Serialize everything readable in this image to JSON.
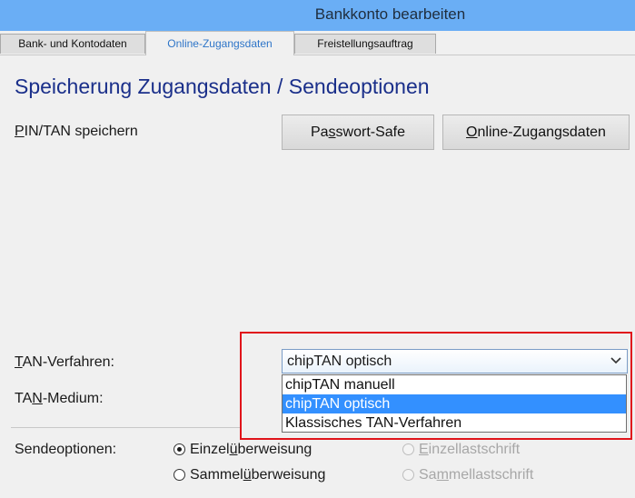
{
  "window": {
    "title": "Bankkonto bearbeiten"
  },
  "tabs": [
    {
      "label": "Bank- und Kontodaten",
      "active": false
    },
    {
      "label": "Online-Zugangsdaten",
      "active": true
    },
    {
      "label": "Freistellungsauftrag",
      "active": false
    }
  ],
  "section": {
    "heading": "Speicherung Zugangsdaten / Sendeoptionen"
  },
  "pin_tan": {
    "label_u": "P",
    "label_rest": "IN/TAN speichern",
    "passwort_safe_pre": "Pa",
    "passwort_safe_u": "s",
    "passwort_safe_post": "swort-Safe",
    "online_zugang_u": "O",
    "online_zugang_rest": "nline-Zugangsdaten"
  },
  "tan_verfahren": {
    "label_u": "T",
    "label_rest": "AN-Verfahren:",
    "selected": "chipTAN optisch",
    "options": [
      "chipTAN manuell",
      "chipTAN optisch",
      "Klassisches TAN-Verfahren"
    ]
  },
  "tan_medium": {
    "label_pre": "TA",
    "label_u": "N",
    "label_rest": "-Medium:"
  },
  "sendeoptionen": {
    "label": "Sendeoptionen:",
    "einzelueberweisung": {
      "pre": "Einzel",
      "u": "ü",
      "post": "berweisung",
      "checked": true
    },
    "sammelueberweisung": {
      "pre": "Sammel",
      "u": "ü",
      "post": "berweisung",
      "checked": false
    },
    "einzellastschrift": {
      "u": "E",
      "post": "inzellastschrift",
      "enabled": false
    },
    "sammellastschrift": {
      "pre": "Sa",
      "u": "m",
      "post": "mellastschrift",
      "enabled": false
    }
  },
  "colors": {
    "titlebar": "#6aaef5",
    "heading": "#1a2f8a",
    "highlight": "#3390ff",
    "annotation_box": "#e0141b"
  }
}
